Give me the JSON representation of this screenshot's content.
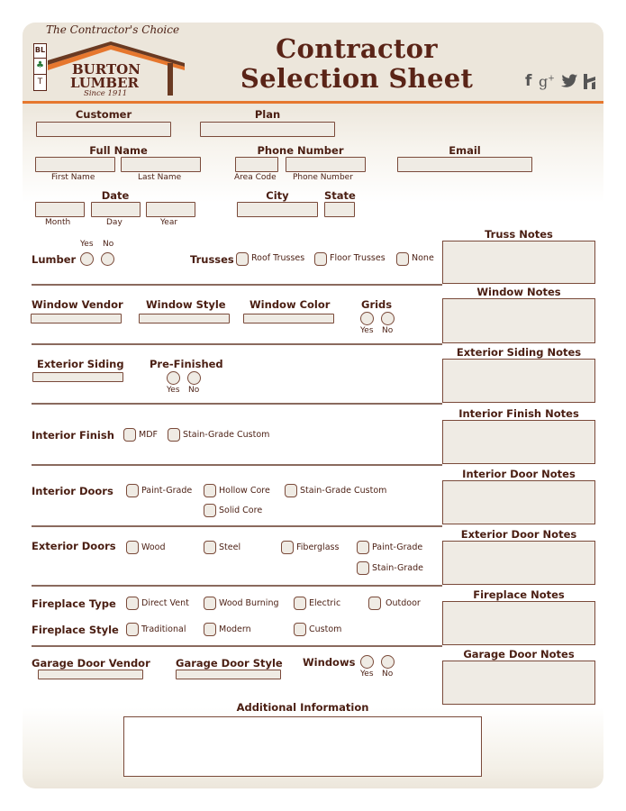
{
  "header": {
    "tagline": "The Contractor's Choice",
    "logo": {
      "badge_top": "BL",
      "badge_mid_icon": "pine-tree-icon",
      "badge_bottom": "T",
      "line1": "BURTON",
      "line2": "LUMBER",
      "line3": "Since 1911"
    },
    "title_line1": "Contractor",
    "title_line2": "Selection Sheet",
    "social": [
      {
        "icon": "facebook-icon",
        "glyph": "f"
      },
      {
        "icon": "google-plus-icon",
        "glyph": "g+"
      },
      {
        "icon": "twitter-icon",
        "glyph": "🐦"
      },
      {
        "icon": "houzz-icon",
        "glyph": "h"
      }
    ]
  },
  "colors": {
    "brand_brown": "#5a2417",
    "accent_orange": "#e6772e",
    "field_fill": "#efebe4",
    "field_border": "#7a4a3a",
    "background": "#ece6db"
  },
  "contact": {
    "customer_label": "Customer",
    "plan_label": "Plan",
    "full_name_label": "Full Name",
    "first_name_sub": "First Name",
    "last_name_sub": "Last Name",
    "phone_label": "Phone Number",
    "area_code_sub": "Area Code",
    "phone_number_sub": "Phone Number",
    "email_label": "Email",
    "date_label": "Date",
    "month_sub": "Month",
    "day_sub": "Day",
    "year_sub": "Year",
    "city_label": "City",
    "state_label": "State"
  },
  "yes": "Yes",
  "no": "No",
  "sections": {
    "lumber": {
      "label": "Lumber"
    },
    "trusses": {
      "label": "Trusses",
      "options": [
        "Roof Trusses",
        "Floor Trusses",
        "None"
      ],
      "notes": "Truss Notes"
    },
    "windows": {
      "vendor": "Window Vendor",
      "style": "Window Style",
      "color": "Window Color",
      "grids": "Grids",
      "notes": "Window Notes"
    },
    "siding": {
      "label": "Exterior Siding",
      "prefinished": "Pre-Finished",
      "notes": "Exterior Siding Notes"
    },
    "interior_finish": {
      "label": "Interior Finish",
      "options": [
        "MDF",
        "Stain-Grade Custom"
      ],
      "notes": "Interior Finish Notes"
    },
    "interior_doors": {
      "label": "Interior Doors",
      "options": [
        "Paint-Grade",
        "Hollow Core",
        "Stain-Grade Custom",
        "Solid Core"
      ],
      "notes": "Interior Door Notes"
    },
    "exterior_doors": {
      "label": "Exterior Doors",
      "options": [
        "Wood",
        "Steel",
        "Fiberglass",
        "Paint-Grade",
        "Stain-Grade"
      ],
      "notes": "Exterior Door Notes"
    },
    "fireplace": {
      "type_label": "Fireplace Type",
      "type_options": [
        "Direct Vent",
        "Wood Burning",
        "Electric",
        "Outdoor"
      ],
      "style_label": "Fireplace Style",
      "style_options": [
        "Traditional",
        "Modern",
        "Custom"
      ],
      "notes": "Fireplace Notes"
    },
    "garage": {
      "vendor": "Garage Door Vendor",
      "style": "Garage Door Style",
      "windows": "Windows",
      "notes": "Garage Door Notes"
    },
    "additional": {
      "label": "Additional Information"
    }
  }
}
